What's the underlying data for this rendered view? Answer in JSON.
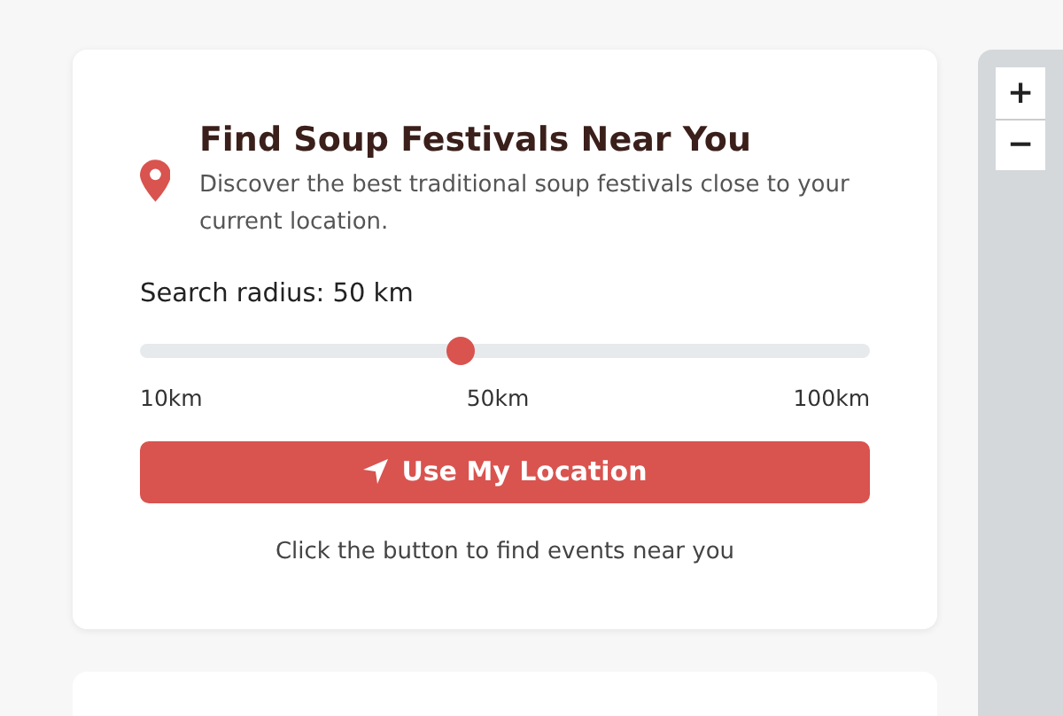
{
  "finder": {
    "title": "Find Soup Festivals Near You",
    "description": "Discover the best traditional soup festivals close to your current location.",
    "radius_label": "Search radius: 50 km",
    "radius": {
      "level": 0.44
    },
    "scale_labels": [
      "10km",
      "50km",
      "100km"
    ],
    "button": "Use My Location",
    "hint": "Click the button to find events near you"
  },
  "map": {
    "zoom_controls": [
      "+",
      "−"
    ]
  }
}
